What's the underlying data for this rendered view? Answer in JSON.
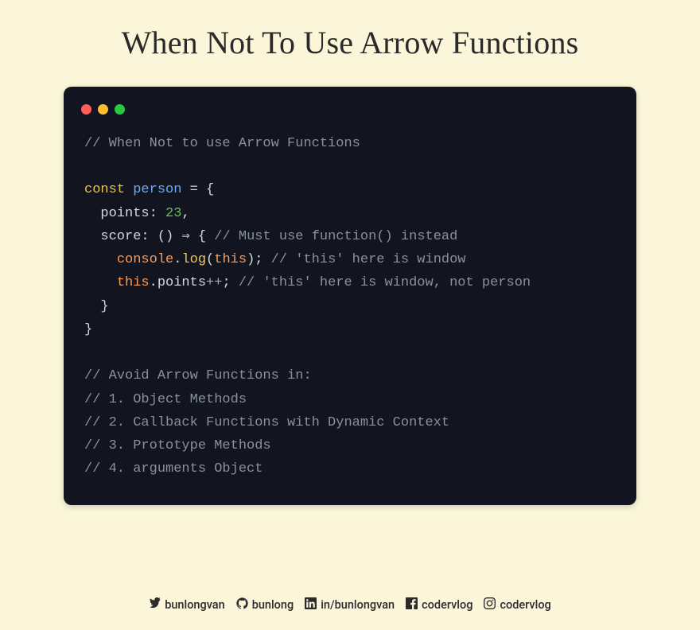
{
  "title": "When Not To Use Arrow Functions",
  "code": {
    "l1_comment": "// When Not to use Arrow Functions",
    "l2_const": "const",
    "l2_ident": "person",
    "l2_eq": " = {",
    "l3_prop": "  points:",
    "l3_val": "23",
    "l3_comma": ",",
    "l4_prop": "  score: () ",
    "l4_arrow": "⇒",
    "l4_brace": " { ",
    "l4_comment": "// Must use function() instead",
    "l5_indent": "    ",
    "l5_console": "console",
    "l5_dot": ".",
    "l5_log": "log",
    "l5_paren_open": "(",
    "l5_this": "this",
    "l5_paren_close": ");",
    "l5_comment": " // 'this' here is window",
    "l6_indent": "    ",
    "l6_this": "this",
    "l6_rest": ".points",
    "l6_op": "++",
    "l6_semi": ";",
    "l6_comment": " // 'this' here is window, not person",
    "l7": "  }",
    "l8": "}",
    "l10": "// Avoid Arrow Functions in:",
    "l11": "// 1. Object Methods",
    "l12": "// 2. Callback Functions with Dynamic Context",
    "l13": "// 3. Prototype Methods",
    "l14": "// 4. arguments Object"
  },
  "socials": {
    "twitter": "bunlongvan",
    "github": "bunlong",
    "linkedin": "in/bunlongvan",
    "facebook": "codervlog",
    "instagram": "codervlog"
  }
}
